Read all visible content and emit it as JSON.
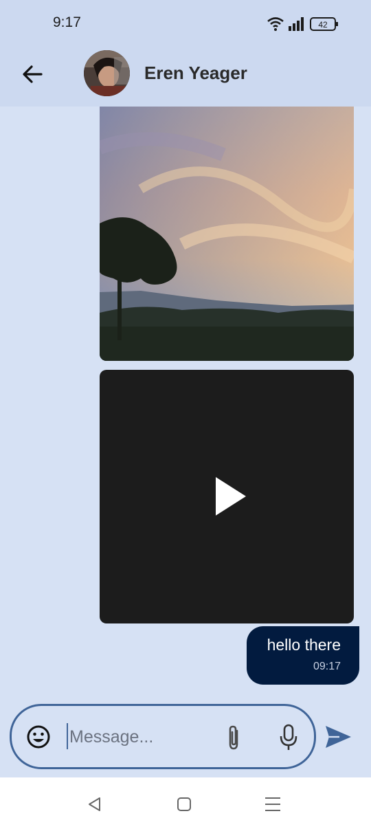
{
  "status_bar": {
    "time": "9:17",
    "battery_level": "42",
    "icons": [
      "wifi-icon",
      "signal-icon",
      "battery-icon"
    ]
  },
  "header": {
    "contact_name": "Eren Yeager",
    "back_icon": "arrow-left-icon",
    "avatar": "contact-avatar"
  },
  "messages": [
    {
      "type": "image",
      "description_icon": "sunset-photo"
    },
    {
      "type": "video",
      "icon": "play-icon"
    },
    {
      "type": "text",
      "text": "hello there",
      "time": "09:17"
    }
  ],
  "composer": {
    "placeholder": "Message...",
    "icons": [
      "emoji-icon",
      "paperclip-icon",
      "microphone-icon",
      "send-icon"
    ]
  },
  "nav_bar": {
    "icons": [
      "nav-back-icon",
      "nav-home-icon",
      "nav-recents-icon"
    ]
  },
  "colors": {
    "background": "#d6e1f4",
    "header": "#ccd9f0",
    "bubble": "#021b3f",
    "accent": "#3f6498",
    "video": "#1c1c1c"
  }
}
